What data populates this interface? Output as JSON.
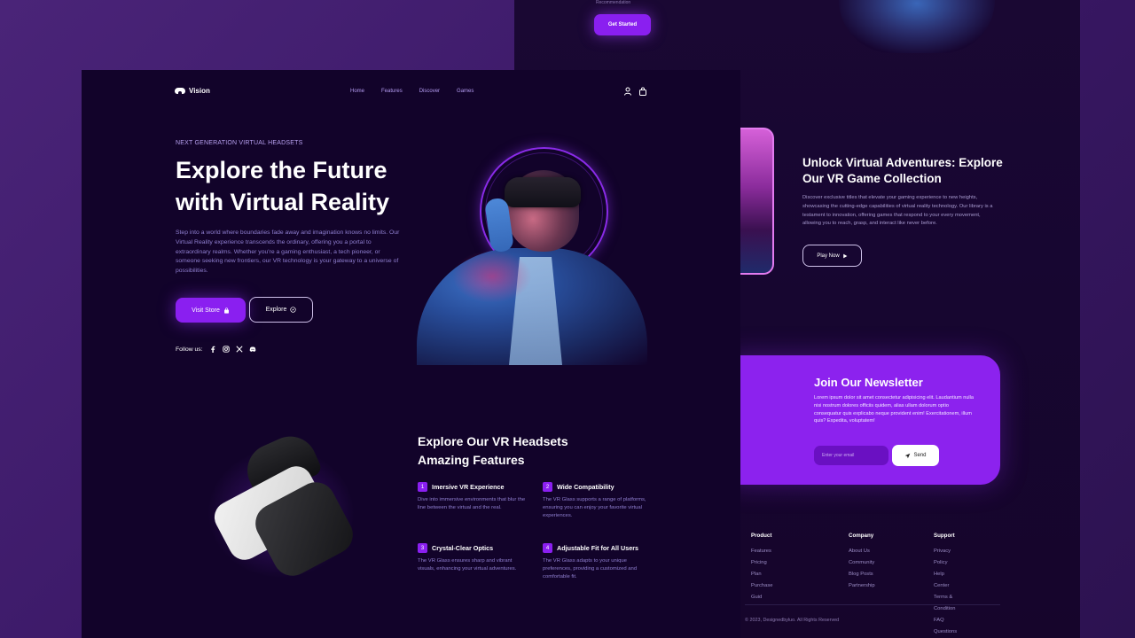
{
  "back": {
    "top_text": "Recommendation",
    "get_started": "Get Started",
    "games_title": "Unlock Virtual Adventures: Explore Our VR Game Collection",
    "games_desc": "Discover exclusive titles that elevate your gaming experience to new heights, showcasing the cutting-edge capabilities of virtual reality technology. Our library is a testament to innovation, offering games that respond to your every movement, allowing you to reach, grasp, and interact like never before.",
    "play_now": "Play Now",
    "newsletter": {
      "title": "Join Our Newsletter",
      "text": "Lorem ipsum dolor sit amet consectetur adipisicing elit. Laudantium nulla nisi nostrum dolores officiis quidem, alias ullam dolorum optio consequatur quis explicabo neque provident enim! Exercitationem, illum quis? Expedita, voluptatem!",
      "placeholder": "Enter your email",
      "send": "Send"
    },
    "footer": {
      "product": {
        "title": "Product",
        "items": [
          "Features",
          "Pricing Plan",
          "Purchase Guid"
        ]
      },
      "company": {
        "title": "Company",
        "items": [
          "About Us",
          "Community",
          "Blog Posts",
          "Partnership"
        ]
      },
      "support": {
        "title": "Support",
        "items": [
          "Privacy Policy",
          "Help Center",
          "Terms & Condition",
          "FAQ Questions"
        ]
      },
      "copyright": "© 2023, Designedbyluo. All Rights Reserved"
    }
  },
  "main": {
    "logo": "Vision",
    "nav": [
      "Home",
      "Features",
      "Discover",
      "Games"
    ],
    "eyebrow": "NEXT GENERATION VIRTUAL HEADSETS",
    "title_line1": "Explore the Future",
    "title_line2": "with Virtual Reality",
    "description": "Step into a world where boundaries fade away and imagination knows no limits. Our Virtual Reality experience transcends the ordinary, offering you a portal to extraordinary realms. Whether you're a gaming enthusiast, a tech pioneer, or someone seeking new frontiers, our VR technology is your gateway to a universe of possibilities.",
    "visit_store": "Visit Store",
    "explore": "Explore",
    "follow_label": "Follow us:",
    "social_icons": [
      "facebook-icon",
      "instagram-icon",
      "x-icon",
      "discord-icon"
    ],
    "features_title_line1": "Explore Our VR Headsets",
    "features_title_line2": "Amazing Features",
    "features": [
      {
        "num": "1",
        "title": "Imersive VR Experience",
        "desc": "Dive into immersive environments that blur the line between the virtual and the real."
      },
      {
        "num": "2",
        "title": "Wide Compatibility",
        "desc": "The VR Glass supports a range of platforms, ensuring you can enjoy your favorite virtual experiences."
      },
      {
        "num": "3",
        "title": "Crystal-Clear Optics",
        "desc": "The VR Glass ensures sharp and vibrant visuals, enhancing your virtual adventures."
      },
      {
        "num": "4",
        "title": "Adjustable Fit for All Users",
        "desc": "The VR Glass adapts to your unique preferences, providing a customized and comfortable fit."
      }
    ]
  },
  "colors": {
    "accent": "#8a1ff0",
    "panel": "#12032a",
    "background": "#3a1866"
  }
}
